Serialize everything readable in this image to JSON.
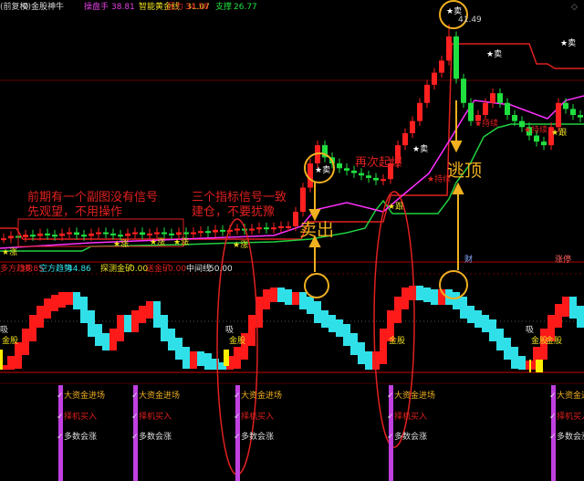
{
  "header": {
    "adjust": "(前复权)",
    "stock_name": "金股神牛",
    "ind1_label": "操盘手",
    "ind1_value": "38.81",
    "ind2_label": "智能黄金线",
    "ind2_value": "31.07",
    "ind3_label": "压力",
    "ind3_value": "34.58",
    "ind4_label": "支撑",
    "ind4_value": "26.77"
  },
  "sub_header": {
    "a_label": "多方趋势",
    "a_value": "36.85",
    "b_label": "空方趋势",
    "b_value": "44.86",
    "c_label": "探测金矿",
    "c_value": "0.00",
    "d_label": "送金矿",
    "d_value": "0.00",
    "e_label": "中间线",
    "e_value": "50.00"
  },
  "annotations": {
    "note1_line1": "前期有一个副图没有信号",
    "note1_line2": "先观望，不用操作",
    "note2_line1": "三个指标信号一致",
    "note2_line2": "建仓，不要犹豫",
    "again": "再次起爆",
    "sell": "卖出",
    "escape": "逃顶",
    "peak_price": "41.49"
  },
  "markers": {
    "sell": "★卖",
    "rise": "★涨",
    "follow": "★跟",
    "hold": "★持续",
    "xi": "吸",
    "jingu": "金股",
    "cai": "财",
    "zt": "涨停"
  },
  "signals": {
    "s1": "大资金进场",
    "s2": "择机买入",
    "s3": "多数会涨"
  },
  "colors": {
    "up": "#ff2020",
    "down": "#20e040",
    "osc_up": "#ff1a1a",
    "osc_down": "#30e0e8",
    "signal_bar": "#c040e0",
    "accent": "#f0b020"
  },
  "chart_data": {
    "type": "candlestick",
    "title": "金股神牛",
    "ylim": [
      22,
      42
    ],
    "closes": [
      23.8,
      24.0,
      23.9,
      24.1,
      24.0,
      24.2,
      24.1,
      24.0,
      24.2,
      24.3,
      24.1,
      24.0,
      24.2,
      24.3,
      24.2,
      24.1,
      24.0,
      24.2,
      24.3,
      24.1,
      24.2,
      24.3,
      24.2,
      24.1,
      24.3,
      24.2,
      24.3,
      24.4,
      24.3,
      24.5,
      24.4,
      24.5,
      24.6,
      24.5,
      24.6,
      24.7,
      24.6,
      24.7,
      24.8,
      24.8,
      26,
      28,
      30,
      31.5,
      30.5,
      30,
      29.6,
      29.4,
      29.2,
      29,
      28.8,
      28.6,
      28.7,
      30,
      31.5,
      32.5,
      33.5,
      35,
      36.5,
      37.5,
      38.5,
      40.5,
      37,
      35,
      33.5,
      34,
      35,
      35.8,
      35,
      34,
      33.5,
      33,
      32.3,
      31.8,
      31.5,
      33,
      35,
      34.5,
      34,
      33.8
    ],
    "peak": 41.49,
    "oscillator": [
      5,
      15,
      30,
      45,
      60,
      70,
      78,
      82,
      85,
      85,
      80,
      65,
      50,
      40,
      35,
      45,
      60,
      55,
      65,
      70,
      75,
      60,
      45,
      35,
      25,
      15,
      20,
      18,
      12,
      8,
      5,
      15,
      25,
      40,
      60,
      80,
      88,
      90,
      88,
      85,
      85,
      80,
      75,
      65,
      60,
      55,
      50,
      40,
      30,
      20,
      10,
      20,
      45,
      65,
      80,
      90,
      92,
      90,
      88,
      85,
      88,
      85,
      80,
      70,
      65,
      60,
      55,
      45,
      35,
      25,
      15,
      8,
      10,
      25,
      45,
      60,
      72,
      80,
      70,
      60
    ]
  }
}
